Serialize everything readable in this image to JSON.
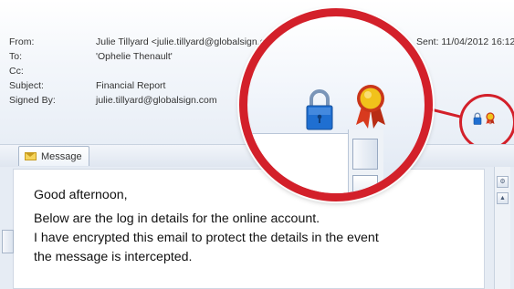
{
  "header": {
    "fields": [
      {
        "label": "From:",
        "value": "Julie Tillyard <julie.tillyard@globalsign.com>"
      },
      {
        "label": "To:",
        "value": "'Ophelie Thenault'"
      },
      {
        "label": "Cc:",
        "value": ""
      },
      {
        "label": "Subject:",
        "value": "Financial Report"
      },
      {
        "label": "Signed By:",
        "value": "julie.tillyard@globalsign.com"
      }
    ],
    "sent": "Sent: 11/04/2012 16:12"
  },
  "tabs": [
    {
      "label": "Message",
      "icon": "envelope-icon"
    }
  ],
  "message": {
    "lines": [
      "Good afternoon,",
      "Below are the log in details for the online account.",
      "I have encrypted this email to protect the details in the event",
      "the message is intercepted."
    ]
  },
  "icons": {
    "encrypted": "lock-icon",
    "signed": "certificate-ribbon-icon"
  },
  "colors": {
    "highlight_red": "#d3202a",
    "lock_blue": "#1f6fd1",
    "ribbon_red": "#d83a1e",
    "medal_gold": "#f1c21b"
  }
}
